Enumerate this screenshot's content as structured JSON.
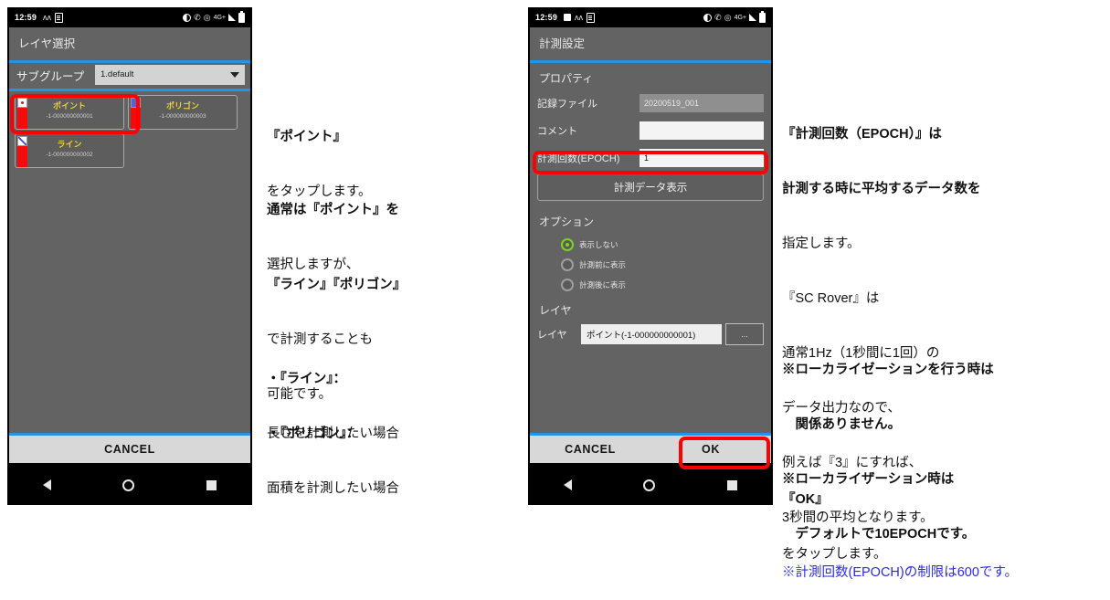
{
  "phone_left": {
    "status_bar": {
      "time": "12:59",
      "left_icons": [
        "vpn-icon",
        "document-icon"
      ],
      "right_icons": [
        "do-not-disturb-icon",
        "missed-call-icon",
        "wifi-off-icon",
        "network-4g-icon",
        "signal-bars-icon",
        "battery-icon"
      ],
      "network_label": "4G+"
    },
    "app_title": "レイヤ選択",
    "subgroup": {
      "label": "サブグループ",
      "selected": "1.default",
      "caret_icon": "chevron-down-icon"
    },
    "layers": [
      {
        "name": "ポイント",
        "id": "-1-000000000001",
        "swatch": "dot"
      },
      {
        "name": "ポリゴン",
        "id": "-1-000000000003",
        "swatch": "fill"
      },
      {
        "name": "ライン",
        "id": "-1-000000000002",
        "swatch": "diag"
      }
    ],
    "buttons": [
      "CANCEL"
    ],
    "nav": [
      "back-button",
      "home-button",
      "recents-button"
    ]
  },
  "phone_right": {
    "status_bar": {
      "time": "12:59",
      "left_icons": [
        "save-icon",
        "vpn-icon",
        "document-icon"
      ],
      "right_icons": [
        "do-not-disturb-icon",
        "missed-call-icon",
        "wifi-off-icon",
        "network-4g-icon",
        "signal-bars-icon",
        "battery-icon"
      ],
      "network_label": "4G+"
    },
    "app_title": "計測設定",
    "property_label": "プロパティ",
    "fields": [
      {
        "label": "記録ファイル",
        "value": "20200519_001",
        "readonly": true
      },
      {
        "label": "コメント",
        "value": "",
        "readonly": false
      },
      {
        "label": "計測回数(EPOCH)",
        "value": "1",
        "readonly": false
      }
    ],
    "show_data_button": "計測データ表示",
    "option_label": "オプション",
    "options": [
      {
        "label": "表示しない",
        "selected": true
      },
      {
        "label": "計測前に表示",
        "selected": false
      },
      {
        "label": "計測後に表示",
        "selected": false
      }
    ],
    "layer_section_label": "レイヤ",
    "layer_row": {
      "label": "レイヤ",
      "value": "ポイント(-1-000000000001)",
      "more_button": "..."
    },
    "buttons": [
      "CANCEL",
      "OK"
    ],
    "nav": [
      "back-button",
      "home-button",
      "recents-button"
    ]
  },
  "annotations": {
    "left": {
      "block1": [
        "『ポイント』",
        "をタップします。"
      ],
      "block2": [
        "通常は『ポイント』を",
        "選択しますが、"
      ],
      "block3": [
        "『ライン』『ポリゴン』",
        "で計測することも",
        "可能です。"
      ],
      "block4": [
        "・『ライン』：",
        "長さを計測したい場合"
      ],
      "block5": [
        "・『ポリゴン』：",
        "面積を計測したい場合"
      ]
    },
    "right": {
      "block1": [
        "『計測回数（EPOCH）』は",
        "計測する時に平均するデータ数を",
        "指定します。",
        "『SC Rover』は",
        "通常1Hz（1秒間に1回）の",
        "データ出力なので、",
        "例えば『3』にすれば、",
        "3秒間の平均となります。",
        "※計測回数(EPOCH)の制限は600です。"
      ],
      "block2": [
        "※ローカライゼーションを行う時は",
        "　関係ありません。",
        "※ローカライザーション時は",
        "　デフォルトで10EPOCHです。"
      ],
      "block3": [
        "『OK』",
        "をタップします。"
      ]
    }
  },
  "colors": {
    "highlight": "#ff0000",
    "accent_blue": "#2196e8",
    "link_blue": "#2b2bdd",
    "layer_name": "#e8d23a",
    "radio_on": "#7ed321"
  }
}
